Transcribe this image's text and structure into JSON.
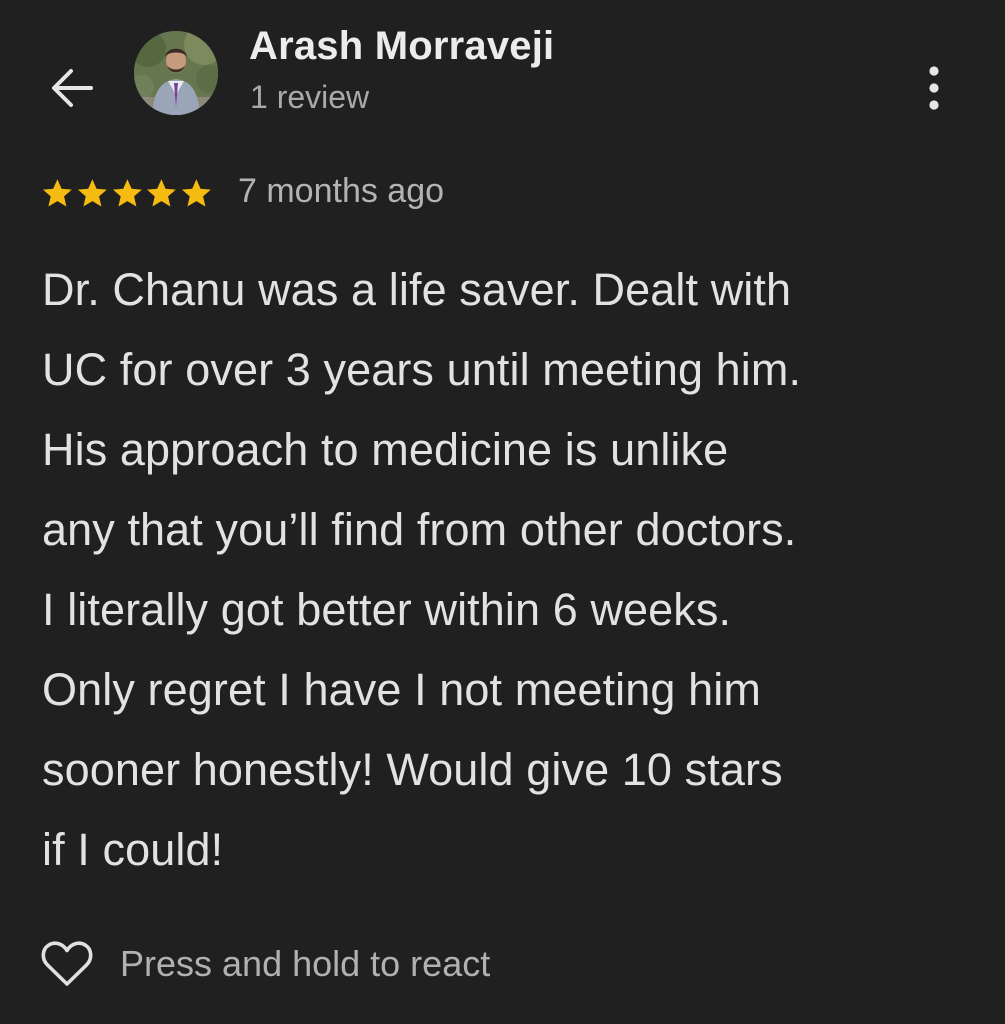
{
  "reviewer": {
    "name": "Arash Morraveji",
    "review_count": "1 review"
  },
  "review": {
    "rating": 5,
    "max_rating": 5,
    "date": "7 months ago",
    "text_lines": [
      "Dr. Chanu was a life saver. Dealt with",
      "UC for over 3 years until meeting him.",
      "His approach to medicine is unlike",
      "any that you’ll find from other doctors.",
      "I literally got better within 6 weeks.",
      "Only regret I have I not meeting him",
      "sooner honestly! Would give 10 stars",
      "if I could!"
    ]
  },
  "footer": {
    "react_label": "Press and hold to react"
  },
  "icons": {
    "back": "arrow-left-icon",
    "more": "more-vertical-icon",
    "star": "star-icon",
    "react": "heart-outline-icon"
  },
  "colors": {
    "background": "#202020",
    "star": "#f6bb10",
    "primary_text": "#e3e3e3",
    "secondary_text": "#a9a9a9"
  }
}
